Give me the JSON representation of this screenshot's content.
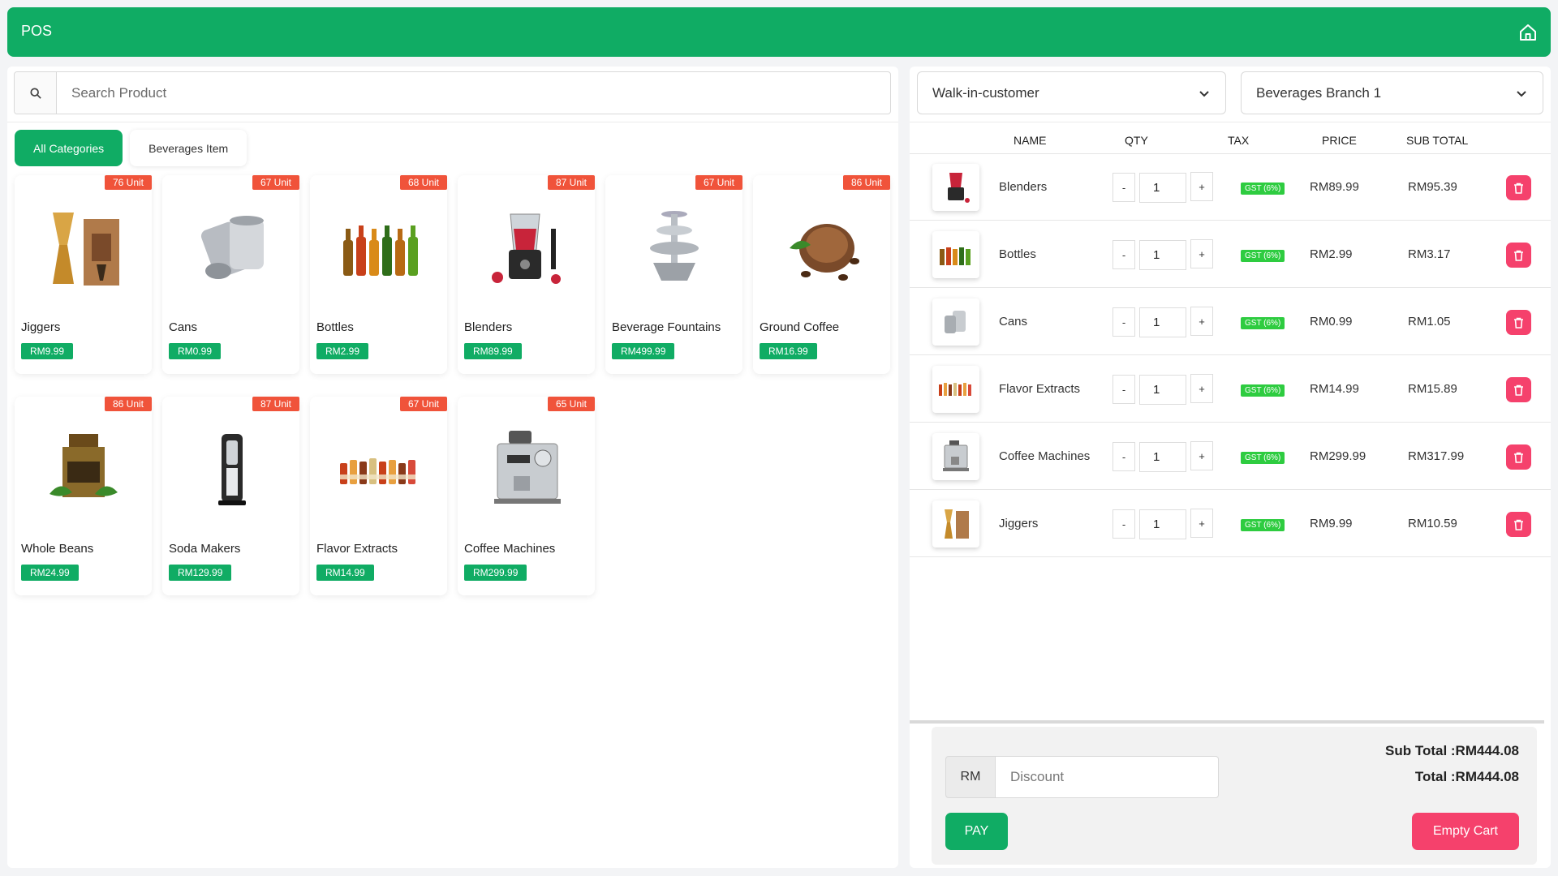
{
  "header": {
    "title": "POS"
  },
  "search": {
    "placeholder": "Search Product"
  },
  "categories": [
    {
      "label": "All Categories"
    },
    {
      "label": "Beverages Item"
    }
  ],
  "products": [
    {
      "name": "Jiggers",
      "price": "RM9.99",
      "stock": "76 Unit"
    },
    {
      "name": "Cans",
      "price": "RM0.99",
      "stock": "67 Unit"
    },
    {
      "name": "Bottles",
      "price": "RM2.99",
      "stock": "68 Unit"
    },
    {
      "name": "Blenders",
      "price": "RM89.99",
      "stock": "87 Unit"
    },
    {
      "name": "Beverage Fountains",
      "price": "RM499.99",
      "stock": "67 Unit"
    },
    {
      "name": "Ground Coffee",
      "price": "RM16.99",
      "stock": "86 Unit"
    },
    {
      "name": "Whole Beans",
      "price": "RM24.99",
      "stock": "86 Unit"
    },
    {
      "name": "Soda Makers",
      "price": "RM129.99",
      "stock": "87 Unit"
    },
    {
      "name": "Flavor Extracts",
      "price": "RM14.99",
      "stock": "67 Unit"
    },
    {
      "name": "Coffee Machines",
      "price": "RM299.99",
      "stock": "65 Unit"
    }
  ],
  "customer_select": {
    "value": "Walk-in-customer"
  },
  "branch_select": {
    "value": "Beverages Branch 1"
  },
  "cart_headers": {
    "name": "NAME",
    "qty": "QTY",
    "tax": "TAX",
    "price": "PRICE",
    "subtotal": "SUB TOTAL"
  },
  "cart": [
    {
      "name": "Blenders",
      "qty": "1",
      "tax": "GST (6%)",
      "price": "RM89.99",
      "subtotal": "RM95.39"
    },
    {
      "name": "Bottles",
      "qty": "1",
      "tax": "GST (6%)",
      "price": "RM2.99",
      "subtotal": "RM3.17"
    },
    {
      "name": "Cans",
      "qty": "1",
      "tax": "GST (6%)",
      "price": "RM0.99",
      "subtotal": "RM1.05"
    },
    {
      "name": "Flavor Extracts",
      "qty": "1",
      "tax": "GST (6%)",
      "price": "RM14.99",
      "subtotal": "RM15.89"
    },
    {
      "name": "Coffee Machines",
      "qty": "1",
      "tax": "GST (6%)",
      "price": "RM299.99",
      "subtotal": "RM317.99"
    },
    {
      "name": "Jiggers",
      "qty": "1",
      "tax": "GST (6%)",
      "price": "RM9.99",
      "subtotal": "RM10.59"
    }
  ],
  "qty_controls": {
    "minus": "-",
    "plus": "+"
  },
  "discount": {
    "currency": "RM",
    "placeholder": "Discount"
  },
  "totals": {
    "subtotal": "Sub Total :RM444.08",
    "total": "Total :RM444.08"
  },
  "actions": {
    "pay": "PAY",
    "empty": "Empty Cart"
  },
  "colors": {
    "primary": "#10ac64",
    "stock_badge": "#f0533a",
    "danger": "#f5416c",
    "tax_badge": "#2ecc40"
  }
}
